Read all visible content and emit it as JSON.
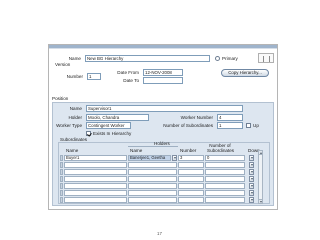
{
  "form": {
    "name_label": "Name",
    "name_value": "New BG Hierarchy",
    "primary_label": "Primary",
    "version_label": "Version",
    "number_label": "Number",
    "number_value": "1",
    "date_from_label": "Date From",
    "date_from_value": "12-NOV-2008",
    "date_to_label": "Date To",
    "date_to_value": "",
    "copy_hierarchy_label": "Copy Hierarchy..."
  },
  "position": {
    "section_label": "Position",
    "name_label": "Name",
    "name_value": "Supervisor1",
    "holder_label": "Holder",
    "holder_value": "Moolo, Chandra",
    "worker_number_label": "Worker Number",
    "worker_number_value": "4",
    "worker_type_label": "Worker Type",
    "worker_type_value": "Contingent Worker",
    "num_subordinates_label": "Number of Subordinates",
    "num_subordinates_value": "1",
    "up_label": "Up",
    "exists_label": "Exists In Hierarchy"
  },
  "subordinates": {
    "section_label": "Subordinates",
    "holders_header": "Holders",
    "col_name": "Name",
    "col_holder_name": "Name",
    "col_number": "Number",
    "col_num_subordinates": "Number of Subordinates",
    "col_down": "Down",
    "rows": [
      {
        "name": "Buyer1",
        "holder": "Banerjee1, Geetha",
        "number": "3",
        "subordinates": "0"
      },
      {
        "name": "",
        "holder": "",
        "number": "",
        "subordinates": ""
      },
      {
        "name": "",
        "holder": "",
        "number": "",
        "subordinates": ""
      },
      {
        "name": "",
        "holder": "",
        "number": "",
        "subordinates": ""
      },
      {
        "name": "",
        "holder": "",
        "number": "",
        "subordinates": ""
      },
      {
        "name": "",
        "holder": "",
        "number": "",
        "subordinates": ""
      },
      {
        "name": "",
        "holder": "",
        "number": "",
        "subordinates": ""
      },
      {
        "name": "",
        "holder": "",
        "number": "",
        "subordinates": ""
      }
    ]
  },
  "page_number": "17",
  "colors": {
    "panel_bg": "#dde6f0",
    "field_border": "#7f9db9",
    "header_strip": "#9fb4cc"
  }
}
